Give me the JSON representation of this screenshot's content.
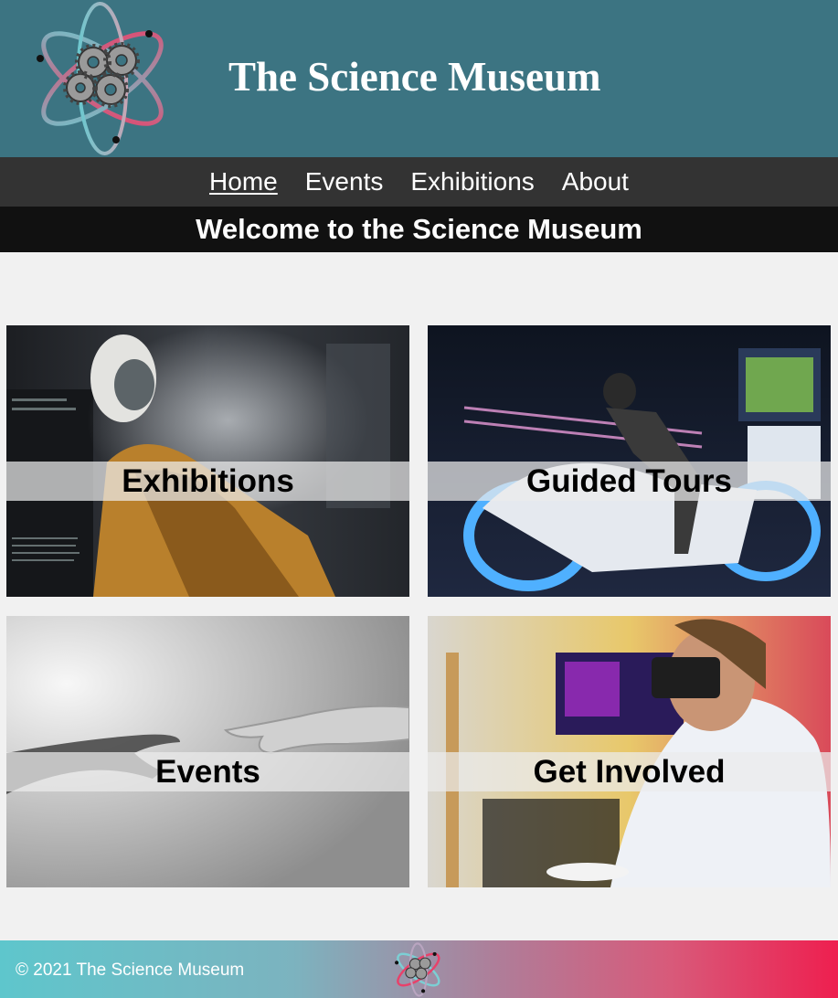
{
  "header": {
    "title": "The Science Museum",
    "logo_icon": "atom-gears-logo"
  },
  "nav": {
    "items": [
      {
        "label": "Home",
        "active": true
      },
      {
        "label": "Events",
        "active": false
      },
      {
        "label": "Exhibitions",
        "active": false
      },
      {
        "label": "About",
        "active": false
      }
    ]
  },
  "welcome": "Welcome to the Science Museum",
  "tiles": [
    {
      "label": "Exhibitions"
    },
    {
      "label": "Guided Tours"
    },
    {
      "label": "Events"
    },
    {
      "label": "Get Involved"
    }
  ],
  "footer": {
    "copyright": "© 2021 The Science Museum",
    "logo_icon": "atom-gears-logo"
  },
  "colors": {
    "header_bg": "#3c7482",
    "nav_bg": "#333333",
    "welcome_bg": "#111111",
    "page_bg": "#f1f1f1",
    "footer_gradient_start": "#5ec6cc",
    "footer_gradient_end": "#ee1f4f"
  }
}
